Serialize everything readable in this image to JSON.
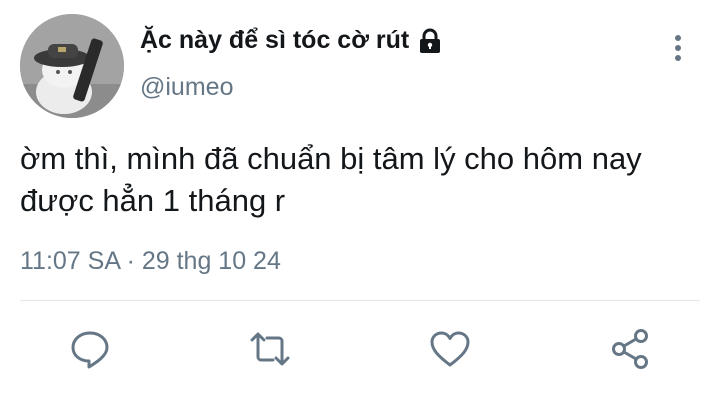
{
  "author": {
    "display_name": "Ặc này để sì tóc cờ rút",
    "handle": "@iumeo",
    "avatar_icon": "avatar-photo",
    "protected_icon": "lock-icon"
  },
  "tweet": {
    "text": "ờm thì, mình đã chuẩn bị tâm lý cho hôm nay được hẳn 1 tháng r",
    "timestamp": "11:07 SA · 29 thg 10 24"
  },
  "actions": {
    "reply_icon": "reply-icon",
    "retweet_icon": "retweet-icon",
    "like_icon": "heart-icon",
    "share_icon": "share-icon",
    "more_icon": "more-vertical-icon"
  },
  "colors": {
    "text_primary": "#14171a",
    "text_secondary": "#657786",
    "icon_color": "#657786",
    "divider": "#e1e8ed"
  }
}
